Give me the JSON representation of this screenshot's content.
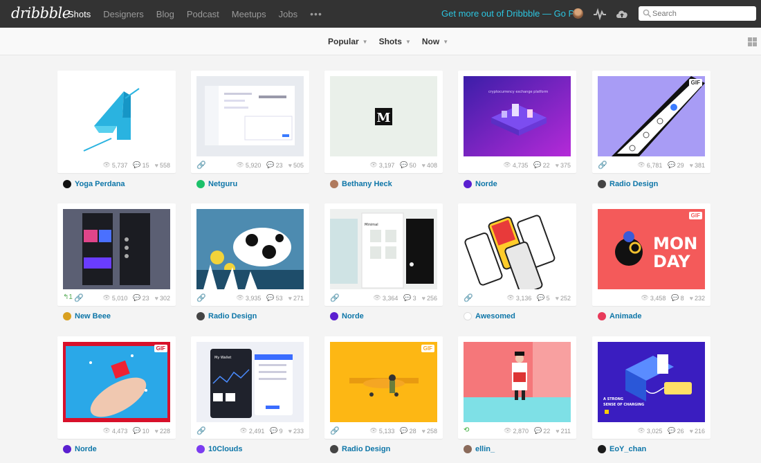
{
  "brand": {
    "logo": "dribbble"
  },
  "nav": {
    "items": [
      "Shots",
      "Designers",
      "Blog",
      "Podcast",
      "Meetups",
      "Jobs"
    ],
    "more": "•••"
  },
  "promo": "Get more out of Dribbble — Go Pro",
  "search": {
    "placeholder": "Search"
  },
  "filters": [
    "Popular",
    "Shots",
    "Now"
  ],
  "shots": [
    {
      "author": "Yoga Perdana",
      "views": "5,737",
      "comments": "15",
      "likes": "558"
    },
    {
      "author": "Netguru",
      "views": "5,920",
      "comments": "23",
      "likes": "505"
    },
    {
      "author": "Bethany Heck",
      "views": "3,197",
      "comments": "50",
      "likes": "408",
      "thumb_text": "M"
    },
    {
      "author": "Norde",
      "views": "4,735",
      "comments": "22",
      "likes": "375",
      "thumb_text": "cryptocurrency exchange platform"
    },
    {
      "author": "Radio Design",
      "views": "6,781",
      "comments": "29",
      "likes": "381",
      "gif": "GIF"
    },
    {
      "author": "New Beee",
      "views": "5,010",
      "comments": "23",
      "likes": "302",
      "rebounds": "1"
    },
    {
      "author": "Radio Design",
      "views": "3,935",
      "comments": "53",
      "likes": "271"
    },
    {
      "author": "Norde",
      "views": "3,364",
      "comments": "3",
      "likes": "256",
      "thumb_text": "Minimal"
    },
    {
      "author": "Awesomed",
      "views": "3,136",
      "comments": "5",
      "likes": "252"
    },
    {
      "author": "Animade",
      "views": "3,458",
      "comments": "8",
      "likes": "232",
      "gif": "GIF",
      "thumb_text": "MON DAY"
    },
    {
      "author": "Norde",
      "views": "4,473",
      "comments": "10",
      "likes": "228",
      "gif": "GIF"
    },
    {
      "author": "10Clouds",
      "views": "2,491",
      "comments": "9",
      "likes": "233",
      "thumb_text": "My Wallet"
    },
    {
      "author": "Radio Design",
      "views": "5,133",
      "comments": "28",
      "likes": "258",
      "gif": "GIF"
    },
    {
      "author": "ellin_",
      "views": "2,870",
      "comments": "22",
      "likes": "211"
    },
    {
      "author": "EoY_chan",
      "views": "3,025",
      "comments": "26",
      "likes": "216",
      "thumb_text": "A STRONG SENSE OF CHARGING"
    }
  ],
  "colors": {
    "topbar": "#333333",
    "promo": "#2cc5e0",
    "author_link": "#0e76a8"
  }
}
